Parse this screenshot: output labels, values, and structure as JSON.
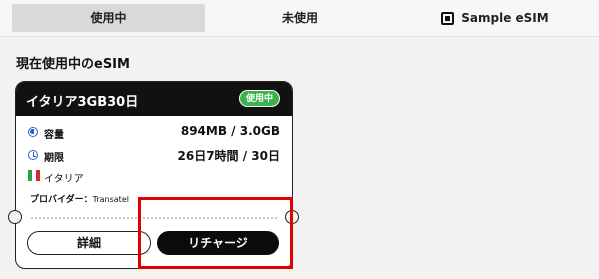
{
  "tabs": [
    {
      "label": "使用中"
    },
    {
      "label": "未使用"
    },
    {
      "label": "Sample eSIM",
      "icon": "sim-chip-icon"
    }
  ],
  "section": {
    "title": "現在使用中のeSIM"
  },
  "card": {
    "plan_name": "イタリア3GB30日",
    "status": "使用中",
    "capacity": {
      "label": "容量",
      "value": "894MB / 3.0GB",
      "icon": "capacity-icon"
    },
    "period": {
      "label": "期限",
      "value": "26日7時間 / 30日",
      "icon": "clock-icon"
    },
    "country": {
      "label": "イタリア",
      "icon": "italy-flag-icon"
    },
    "provider": {
      "label": "プロバイダー：",
      "value": "Transatel"
    }
  },
  "buttons": {
    "detail": "詳細",
    "recharge": "リチャージ"
  },
  "colors": {
    "status_badge": "#3bb24a",
    "highlight": "#e10000",
    "header_bg": "#111111"
  }
}
